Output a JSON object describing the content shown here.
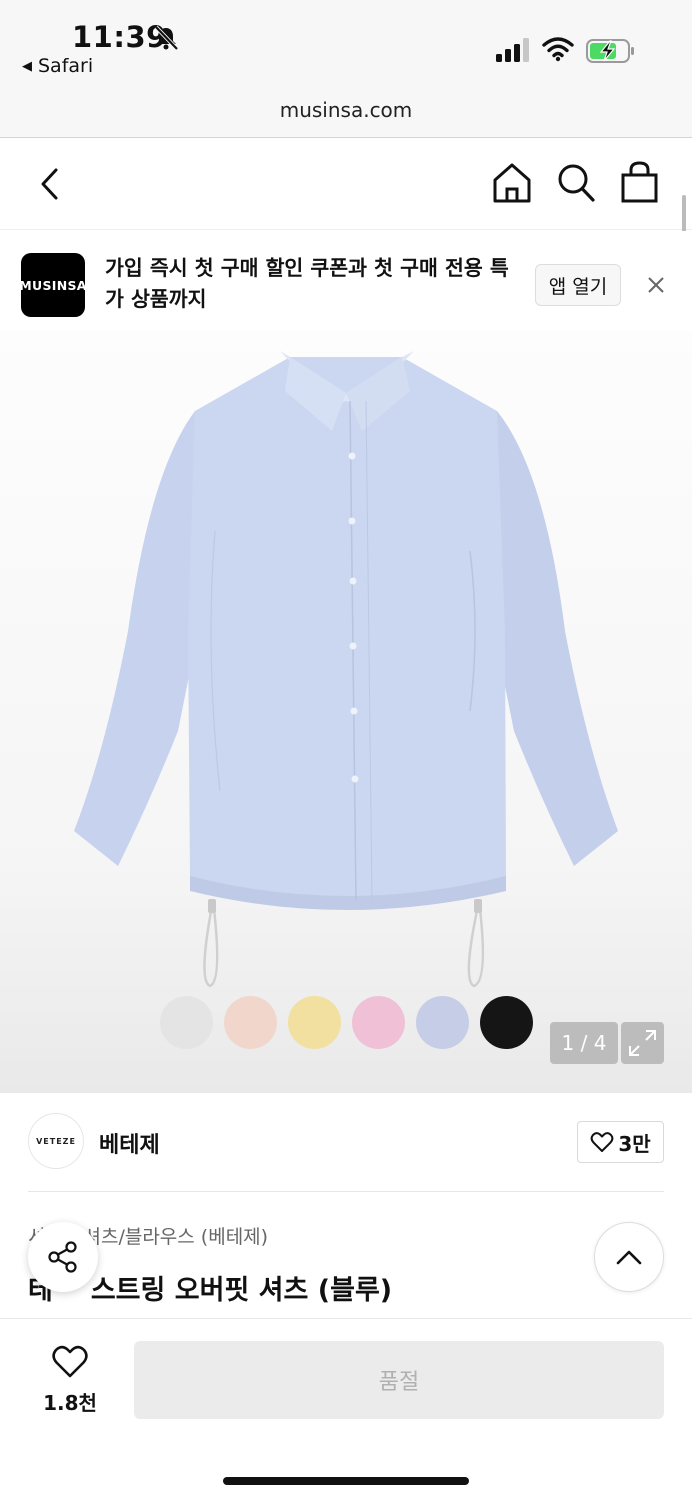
{
  "status_bar": {
    "time": "11:39",
    "back_app": "Safari"
  },
  "browser": {
    "url": "musinsa.com"
  },
  "nav": {
    "back_icon": "chevron-left-icon",
    "home_icon": "home-icon",
    "search_icon": "search-icon",
    "cart_icon": "shopping-bag-icon"
  },
  "banner": {
    "logo_text": "MUSINSA",
    "message": "가입 즉시 첫 구매 할인 쿠폰과 첫 구매 전용 특가 상품까지",
    "open_app_label": "앱 열기"
  },
  "gallery": {
    "swatch_colors": [
      "#e4e4e4",
      "#f1d6cc",
      "#f1e09f",
      "#efc0d6",
      "#c6cde6",
      "#151515"
    ],
    "counter": "1 / 4"
  },
  "brand": {
    "logo_text": "VETEZE",
    "name": "베테제",
    "like_count": "3만"
  },
  "product": {
    "category": "셔츠/블라우스 (베테제)",
    "category_prefix": "셔",
    "title": "스트링 오버핏 셔츠 (블루)",
    "title_prefix": "테",
    "accent_color": "#c9d6ef"
  },
  "bottom_bar": {
    "wish_count": "1.8천",
    "buy_label": "품절"
  }
}
